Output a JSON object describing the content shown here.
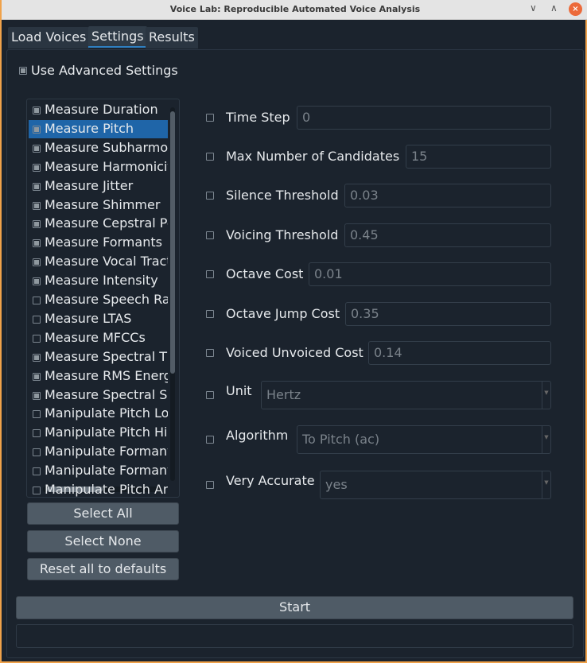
{
  "window": {
    "title": "Voice Lab: Reproducible Automated Voice Analysis"
  },
  "tabs": [
    {
      "label": "Load Voices"
    },
    {
      "label": "Settings",
      "active": true
    },
    {
      "label": "Results"
    }
  ],
  "advanced": {
    "label": "Use Advanced Settings",
    "checked": true
  },
  "functions": [
    {
      "label": "Measure Duration",
      "checked": true
    },
    {
      "label": "Measure Pitch",
      "checked": true,
      "selected": true
    },
    {
      "label": "Measure Subharmonics",
      "checked": true
    },
    {
      "label": "Measure Harmonicity",
      "checked": true
    },
    {
      "label": "Measure Jitter",
      "checked": true
    },
    {
      "label": "Measure Shimmer",
      "checked": true
    },
    {
      "label": "Measure Cepstral Peak Prominence",
      "checked": true
    },
    {
      "label": "Measure Formants",
      "checked": true
    },
    {
      "label": "Measure Vocal Tract Estimates",
      "checked": true
    },
    {
      "label": "Measure Intensity",
      "checked": true
    },
    {
      "label": "Measure Speech Rate",
      "checked": false
    },
    {
      "label": "Measure LTAS",
      "checked": false
    },
    {
      "label": "Measure MFCCs",
      "checked": false
    },
    {
      "label": "Measure Spectral Tilt",
      "checked": true
    },
    {
      "label": "Measure RMS Energy",
      "checked": true
    },
    {
      "label": "Measure Spectral Shape",
      "checked": true
    },
    {
      "label": "Manipulate Pitch Lower",
      "checked": false
    },
    {
      "label": "Manipulate Pitch Higher",
      "checked": false
    },
    {
      "label": "Manipulate Formants Lower",
      "checked": false
    },
    {
      "label": "Manipulate Formants Higher",
      "checked": false
    },
    {
      "label": "Manipulate Pitch And Formants",
      "checked": false
    }
  ],
  "buttons": {
    "select_all": "Select All",
    "select_none": "Select None",
    "reset": "Reset all to defaults",
    "start": "Start"
  },
  "settings": [
    {
      "label": "Time Step",
      "value": "0",
      "type": "text"
    },
    {
      "label": "Max Number of Candidates",
      "value": "15",
      "type": "text"
    },
    {
      "label": "Silence Threshold",
      "value": "0.03",
      "type": "text"
    },
    {
      "label": "Voicing Threshold",
      "value": "0.45",
      "type": "text"
    },
    {
      "label": "Octave Cost",
      "value": "0.01",
      "type": "text"
    },
    {
      "label": "Octave Jump Cost",
      "value": "0.35",
      "type": "text"
    },
    {
      "label": "Voiced Unvoiced Cost",
      "value": "0.14",
      "type": "text"
    },
    {
      "label": "Unit",
      "value": "Hertz",
      "type": "select"
    },
    {
      "label": "Algorithm",
      "value": "To Pitch (ac)",
      "type": "select"
    },
    {
      "label": "Very Accurate",
      "value": "yes",
      "type": "select"
    }
  ],
  "colors": {
    "background": "#1b232d",
    "selection": "#1f65a8",
    "button": "#4f5b66",
    "window_border": "#f0a24a"
  }
}
